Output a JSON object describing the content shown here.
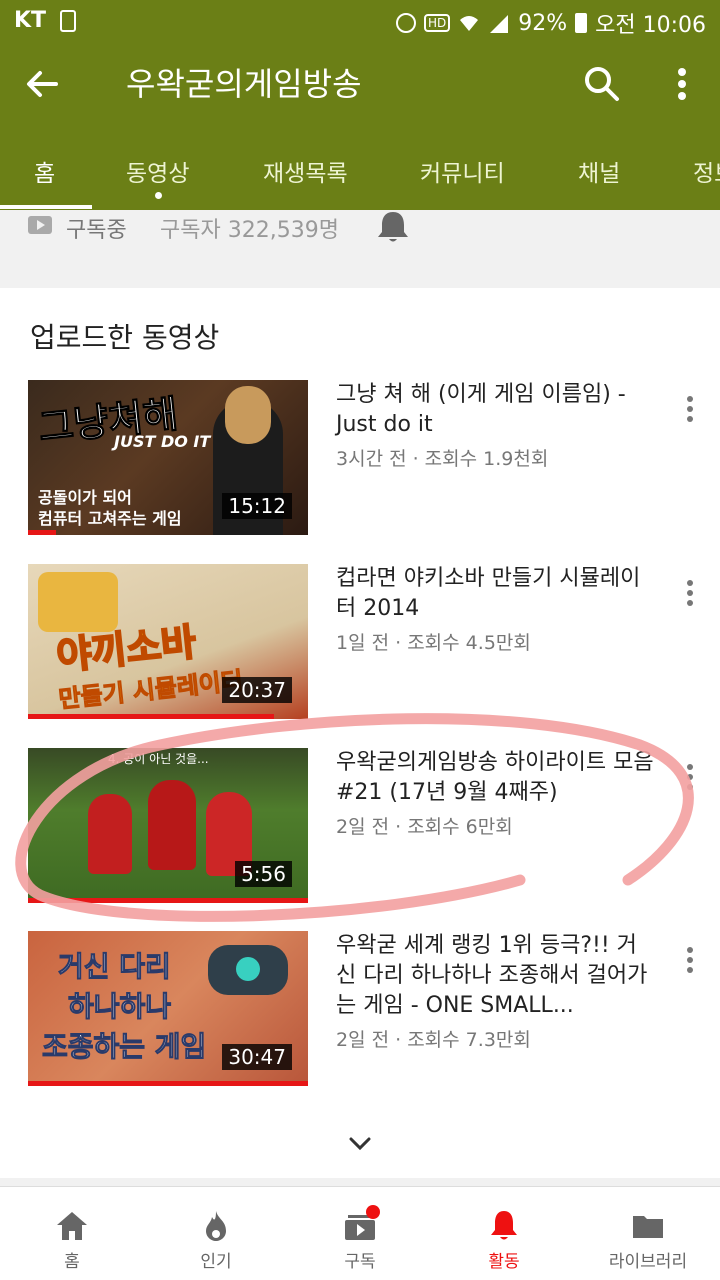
{
  "status_bar": {
    "carrier": "KT",
    "battery": "92%",
    "time": "오전 10:06",
    "icons": [
      "phone-icon",
      "alarm-icon",
      "hd-icon",
      "wifi-icon",
      "signal-icon",
      "battery-icon"
    ]
  },
  "app_bar": {
    "channel_title": "우왁굳의게임방송",
    "icons": [
      "back-arrow-icon",
      "search-icon",
      "more-vert-icon"
    ],
    "tabs": [
      "홈",
      "동영상",
      "재생목록",
      "커뮤니티",
      "채널",
      "정보"
    ]
  },
  "subscription": {
    "status": "구독중",
    "subscriber_count": "구독자 322,539명",
    "icon": "notification-bell-icon"
  },
  "uploads": {
    "title": "업로드한 동영상",
    "videos": [
      {
        "title": "그냥 쳐 해 (이게 게임 이름임) - Just do it",
        "meta": "3시간 전 · 조회수 1.9천회",
        "duration": "15:12",
        "thumb_big": "그냥쳐해",
        "thumb_sub": "JUST DO IT",
        "thumb_caption_1": "공돌이가 되어",
        "thumb_caption_2": "컴퓨터 고쳐주는 게임",
        "watched": 0.1
      },
      {
        "title": "컵라면 야키소바 만들기 시뮬레이터 2014",
        "meta": "1일 전 · 조회수 4.5만회",
        "duration": "20:37",
        "thumb_big": "야끼소바",
        "thumb_sub": "만들기 시뮬레이터",
        "watched": 0.88
      },
      {
        "title": "우왁굳의게임방송 하이라이트 모음 #21 (17년 9월 4째주)",
        "meta": "2일 전 · 조회수 6만회",
        "duration": "5:56",
        "thumb_caption": "4. 공이 아닌 것을...",
        "watched": 1.0
      },
      {
        "title": "우왁굳 세계 랭킹 1위 등극?!! 거신 다리 하나하나 조종해서 걸어가는 게임 - ONE SMALL...",
        "meta": "2일 전 · 조회수 7.3만회",
        "duration": "30:47",
        "thumb_line_1": "거신 다리",
        "thumb_line_2": "하나하나",
        "thumb_line_3": "조종하는 게임",
        "watched": 1.0
      }
    ],
    "expand_icon": "chevron-down-icon"
  },
  "bottom_nav": [
    {
      "label": "홈",
      "icon": "home-icon"
    },
    {
      "label": "인기",
      "icon": "fire-icon"
    },
    {
      "label": "구독",
      "icon": "subscriptions-icon"
    },
    {
      "label": "활동",
      "icon": "bell-icon"
    },
    {
      "label": "라이브러리",
      "icon": "folder-icon"
    }
  ],
  "colors": {
    "app_bar": "#6b7f16",
    "accent_red": "#e61616",
    "annotation": "#f3a0a0"
  }
}
